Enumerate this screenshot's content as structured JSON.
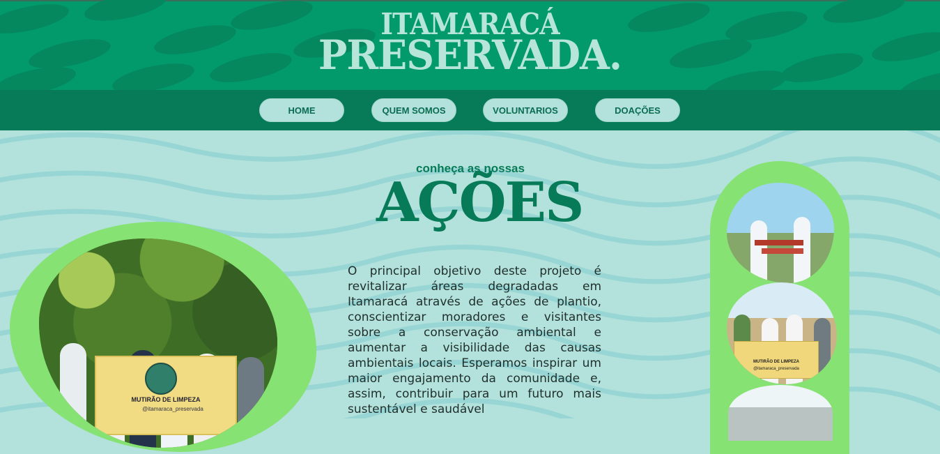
{
  "header": {
    "logo_line1": "ITAMARACÁ",
    "logo_line2": "PRESERVADA."
  },
  "nav": {
    "items": [
      {
        "label": "HOME"
      },
      {
        "label": "QUEM SOMOS"
      },
      {
        "label": "VOLUNTARIOS"
      },
      {
        "label": "DOAÇÕES"
      }
    ]
  },
  "section": {
    "subtitle": "conheça as nossas",
    "title": "AÇÕES",
    "paragraph": "O principal objetivo deste projeto é revitalizar áreas degradadas em Itamaracá através de ações de plantio, conscientizar moradores e visitantes sobre a conservação ambiental e aumentar a visibilidade das causas ambientais locais. Esperamos inspirar um maior engajamento da comunidade e, assim, contribuir para um futuro mais sustentável e saudável"
  },
  "photos": {
    "left_banner_title": "MUTIRÃO DE LIMPEZA",
    "left_banner_handle": "@itamaraca_preservada",
    "right_banner_title": "MUTIRÃO DE LIMPEZA",
    "right_banner_handle": "@itamaraca_preservada"
  },
  "colors": {
    "header_green": "#029a6b",
    "nav_green": "#077b58",
    "background": "#b3e1dc",
    "accent_green": "#86e273",
    "logo_text": "#b7e6d9"
  }
}
